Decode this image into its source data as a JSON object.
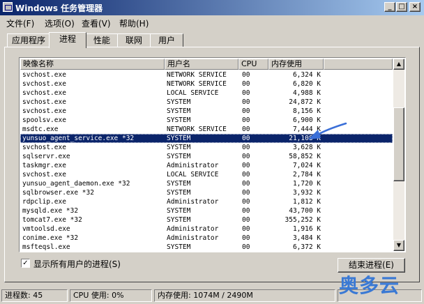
{
  "window": {
    "title": "Windows 任务管理器"
  },
  "menu": [
    "文件(F)",
    "选项(O)",
    "查看(V)",
    "帮助(H)"
  ],
  "tabs": [
    {
      "label": "应用程序",
      "active": false
    },
    {
      "label": "进程",
      "active": true
    },
    {
      "label": "性能",
      "active": false
    },
    {
      "label": "联网",
      "active": false
    },
    {
      "label": "用户",
      "active": false
    }
  ],
  "columns": {
    "name": "映像名称",
    "user": "用户名",
    "cpu": "CPU",
    "mem": "内存使用"
  },
  "processes": [
    {
      "name": "svchost.exe",
      "user": "NETWORK SERVICE",
      "cpu": "00",
      "mem": "6,324 K"
    },
    {
      "name": "svchost.exe",
      "user": "NETWORK SERVICE",
      "cpu": "00",
      "mem": "6,820 K"
    },
    {
      "name": "svchost.exe",
      "user": "LOCAL SERVICE",
      "cpu": "00",
      "mem": "4,988 K"
    },
    {
      "name": "svchost.exe",
      "user": "SYSTEM",
      "cpu": "00",
      "mem": "24,872 K"
    },
    {
      "name": "svchost.exe",
      "user": "SYSTEM",
      "cpu": "00",
      "mem": "8,156 K"
    },
    {
      "name": "spoolsv.exe",
      "user": "SYSTEM",
      "cpu": "00",
      "mem": "6,900 K"
    },
    {
      "name": "msdtc.exe",
      "user": "NETWORK SERVICE",
      "cpu": "00",
      "mem": "7,444 K"
    },
    {
      "name": "yunsuo_agent_service.exe *32",
      "user": "SYSTEM",
      "cpu": "00",
      "mem": "21,108 K",
      "selected": true
    },
    {
      "name": "svchost.exe",
      "user": "SYSTEM",
      "cpu": "00",
      "mem": "3,628 K"
    },
    {
      "name": "sqlservr.exe",
      "user": "SYSTEM",
      "cpu": "00",
      "mem": "58,852 K"
    },
    {
      "name": "taskmgr.exe",
      "user": "Administrator",
      "cpu": "00",
      "mem": "7,024 K"
    },
    {
      "name": "svchost.exe",
      "user": "LOCAL SERVICE",
      "cpu": "00",
      "mem": "2,784 K"
    },
    {
      "name": "yunsuo_agent_daemon.exe *32",
      "user": "SYSTEM",
      "cpu": "00",
      "mem": "1,720 K"
    },
    {
      "name": "sqlbrowser.exe *32",
      "user": "SYSTEM",
      "cpu": "00",
      "mem": "3,932 K"
    },
    {
      "name": "rdpclip.exe",
      "user": "Administrator",
      "cpu": "00",
      "mem": "1,812 K"
    },
    {
      "name": "mysqld.exe *32",
      "user": "SYSTEM",
      "cpu": "00",
      "mem": "43,700 K"
    },
    {
      "name": "tomcat7.exe *32",
      "user": "SYSTEM",
      "cpu": "00",
      "mem": "355,252 K"
    },
    {
      "name": "vmtoolsd.exe",
      "user": "Administrator",
      "cpu": "00",
      "mem": "1,916 K"
    },
    {
      "name": "conime.exe *32",
      "user": "Administrator",
      "cpu": "00",
      "mem": "3,484 K"
    },
    {
      "name": "msfteqsl.exe",
      "user": "SYSTEM",
      "cpu": "00",
      "mem": "6,372 K"
    }
  ],
  "options": {
    "show_all_users": "显示所有用户的进程(S)",
    "show_all_checked": true,
    "end_process": "结束进程(E)"
  },
  "status": {
    "processes": "进程数: 45",
    "cpu": "CPU 使用: 0%",
    "memory": "内存使用: 1074M / 2490M"
  },
  "watermark": "奥多云",
  "colors": {
    "selection": "#0a246a",
    "arrow": "#3a6fd8",
    "watermark": "#3a79d4"
  }
}
